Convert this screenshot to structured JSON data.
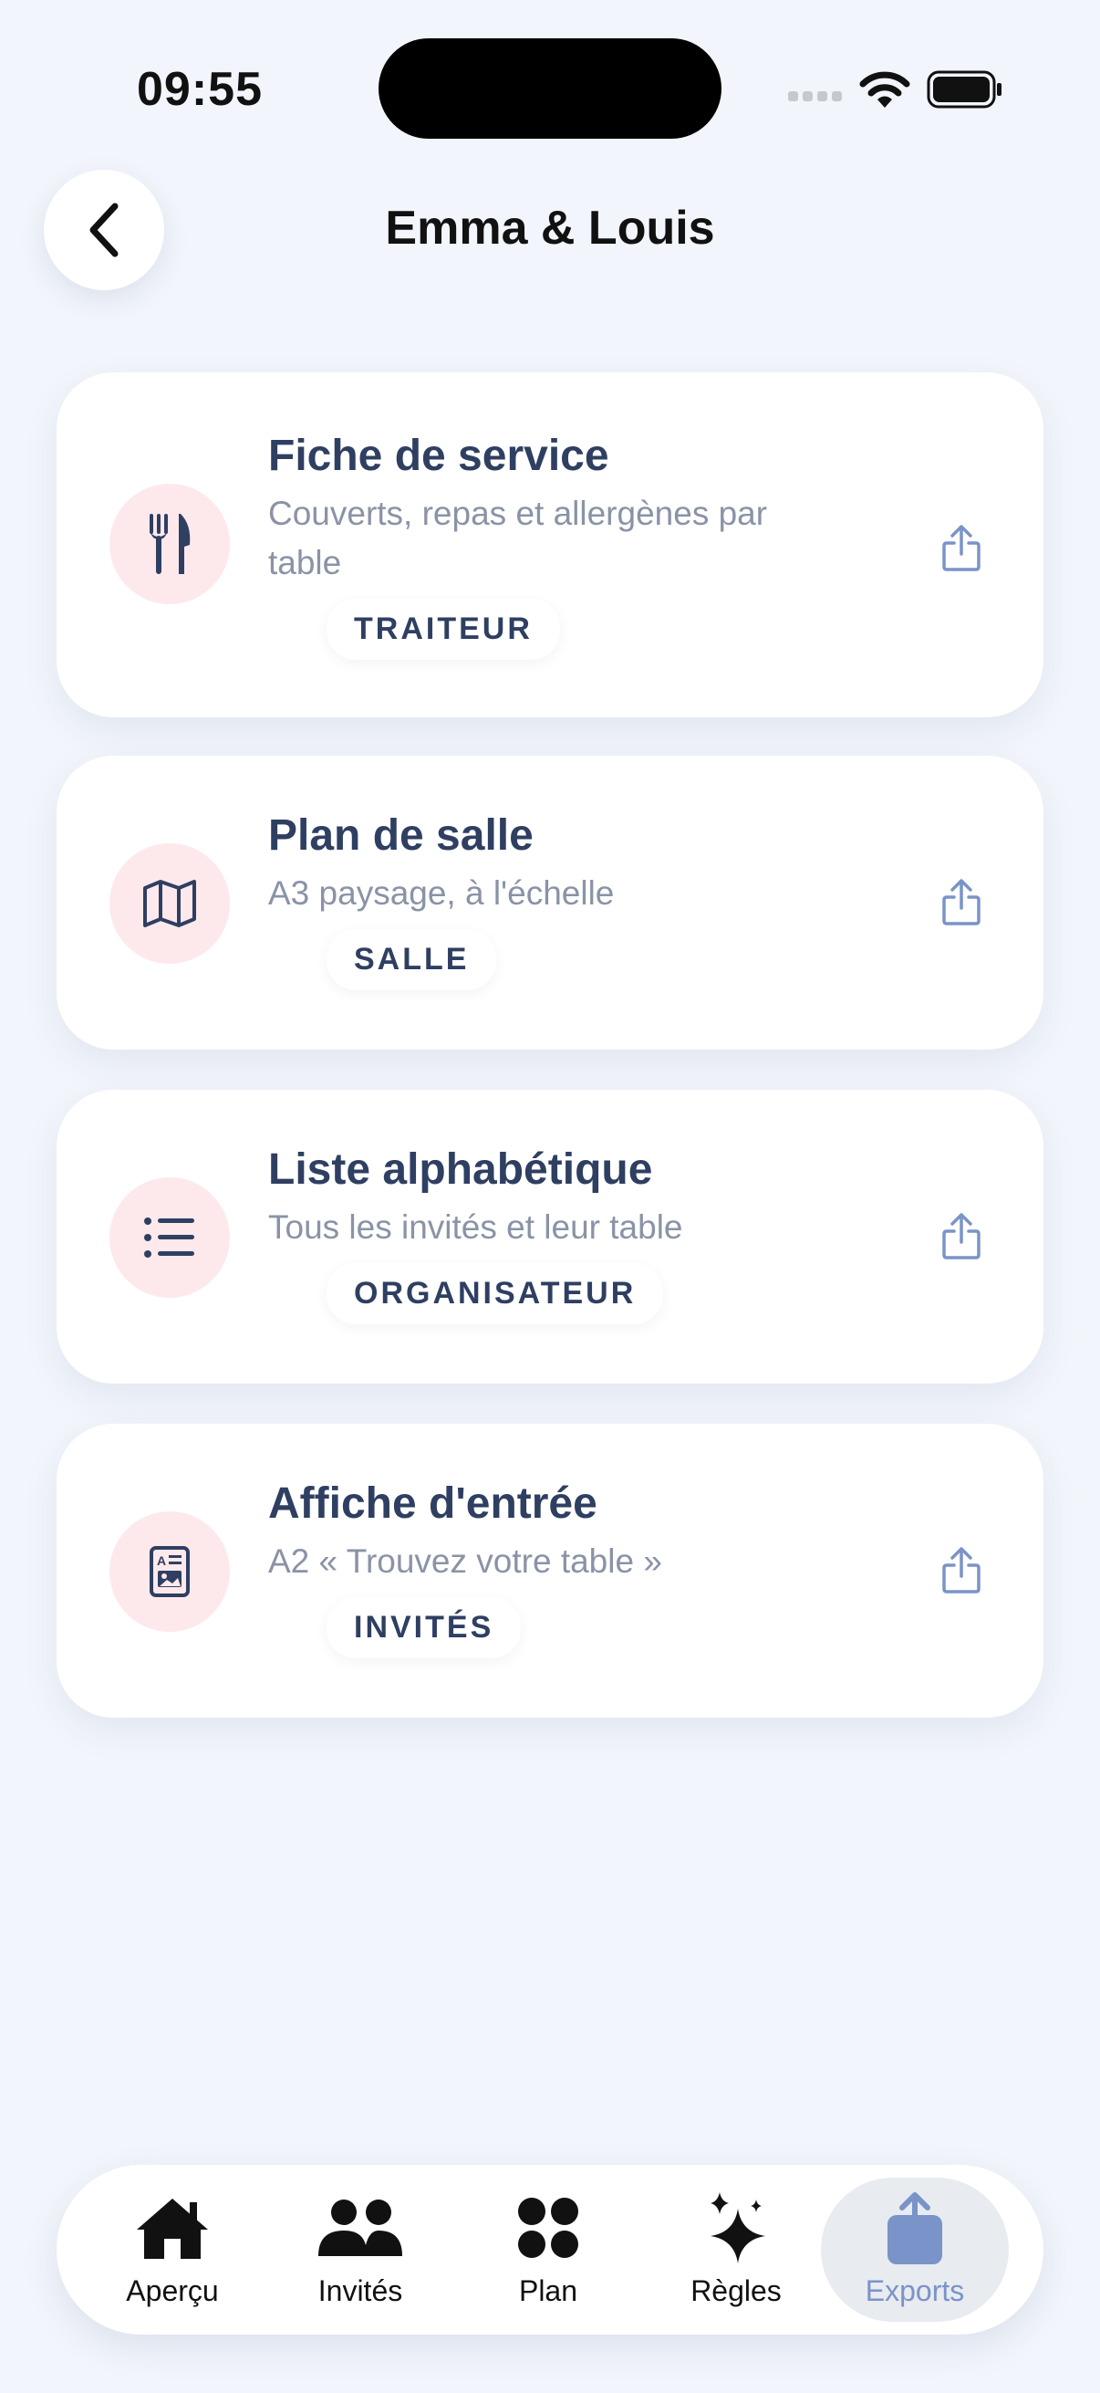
{
  "status_bar": {
    "time": "09:55"
  },
  "header": {
    "title": "Emma & Louis"
  },
  "cards": [
    {
      "icon": "fork-knife-icon",
      "title": "Fiche de service",
      "description": "Couverts, repas et allergènes par table",
      "tag": "TRAITEUR"
    },
    {
      "icon": "map-icon",
      "title": "Plan de salle",
      "description": "A3 paysage, à l'échelle",
      "tag": "SALLE"
    },
    {
      "icon": "list-icon",
      "title": "Liste alphabétique",
      "description": "Tous les invités et leur table",
      "tag": "ORGANISATEUR"
    },
    {
      "icon": "poster-icon",
      "title": "Affiche d'entrée",
      "description": "A2 « Trouvez votre table »",
      "tag": "INVITÉS"
    }
  ],
  "tabbar": {
    "tabs": [
      {
        "label": "Aperçu",
        "icon": "house-icon"
      },
      {
        "label": "Invités",
        "icon": "people-icon"
      },
      {
        "label": "Plan",
        "icon": "circles-icon"
      },
      {
        "label": "Règles",
        "icon": "sparkles-icon"
      },
      {
        "label": "Exports",
        "icon": "share-icon",
        "active": true
      }
    ]
  },
  "colors": {
    "accent": "#7a93c9",
    "icon_bg": "#fde9ec",
    "text": "#2f3f62",
    "muted": "#8a93a6",
    "background": "#f2f5fb"
  }
}
